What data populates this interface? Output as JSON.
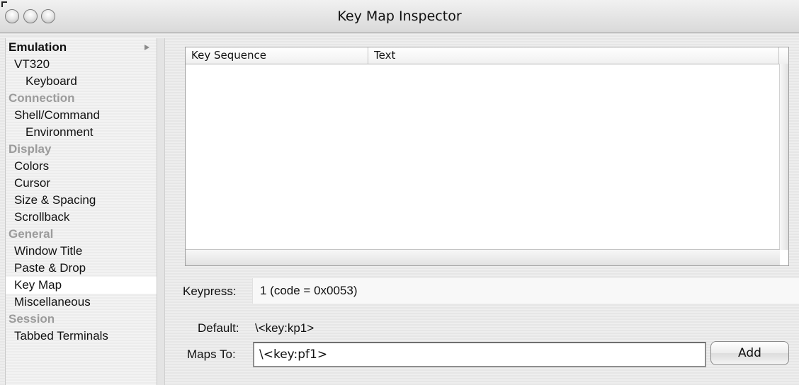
{
  "window": {
    "title": "Key Map Inspector"
  },
  "sidebar": {
    "items": [
      {
        "label": "Emulation",
        "kind": "header-active"
      },
      {
        "label": "VT320",
        "kind": "lvl1"
      },
      {
        "label": "Keyboard",
        "kind": "lvl2"
      },
      {
        "label": "Connection",
        "kind": "header"
      },
      {
        "label": "Shell/Command",
        "kind": "lvl1"
      },
      {
        "label": "Environment",
        "kind": "lvl2"
      },
      {
        "label": "Display",
        "kind": "header"
      },
      {
        "label": "Colors",
        "kind": "lvl1"
      },
      {
        "label": "Cursor",
        "kind": "lvl1"
      },
      {
        "label": "Size & Spacing",
        "kind": "lvl1"
      },
      {
        "label": "Scrollback",
        "kind": "lvl1"
      },
      {
        "label": "General",
        "kind": "header"
      },
      {
        "label": "Window Title",
        "kind": "lvl1"
      },
      {
        "label": "Paste & Drop",
        "kind": "lvl1"
      },
      {
        "label": "Key Map",
        "kind": "lvl1",
        "selected": true
      },
      {
        "label": "Miscellaneous",
        "kind": "lvl1"
      },
      {
        "label": "Session",
        "kind": "header"
      },
      {
        "label": "Tabbed Terminals",
        "kind": "lvl1"
      }
    ]
  },
  "table": {
    "columns": [
      "Key Sequence",
      "Text"
    ],
    "rows": []
  },
  "form": {
    "keypress_label": "Keypress:",
    "keypress_value": "1 (code = 0x0053)",
    "default_label": "Default:",
    "default_value": "\\<key:kp1>",
    "maps_to_label": "Maps To:",
    "maps_to_value": "\\<key:pf1>",
    "add_label": "Add"
  }
}
